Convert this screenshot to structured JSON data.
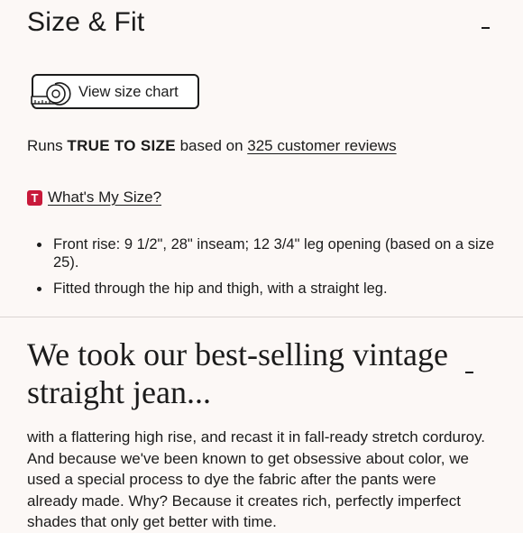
{
  "size_fit": {
    "title": "Size & Fit",
    "size_chart_label": "View size chart",
    "runs_prefix": "Runs",
    "runs_fit": "TRUE TO SIZE",
    "runs_middle": "based on",
    "reviews_link": "325 customer reviews",
    "badge_letter": "T",
    "whats_my_size": "What's My Size?",
    "bullets": [
      "Front rise: 9 1/2\", 28\" inseam; 12 3/4\" leg opening (based on a size 25).",
      "Fitted through the hip and thigh, with a straight leg."
    ]
  },
  "description": {
    "title": "We took our best-selling vintage straight jean...",
    "body": "with a flattering high rise, and recast it in fall-ready stretch corduroy. And because we've been known to get obsessive about color, we used a special process to dye the fabric after the pants were already made. Why? Because it creates rich, perfectly imperfect shades that only get better with time."
  },
  "colors": {
    "background": "#fcf8f6",
    "text": "#1b1b1b",
    "badge": "#c8193a",
    "divider": "#dad5d2"
  },
  "icons": {
    "collapse": "minus-icon",
    "size_chart": "measuring-tape-icon",
    "badge": "t-badge-icon"
  }
}
